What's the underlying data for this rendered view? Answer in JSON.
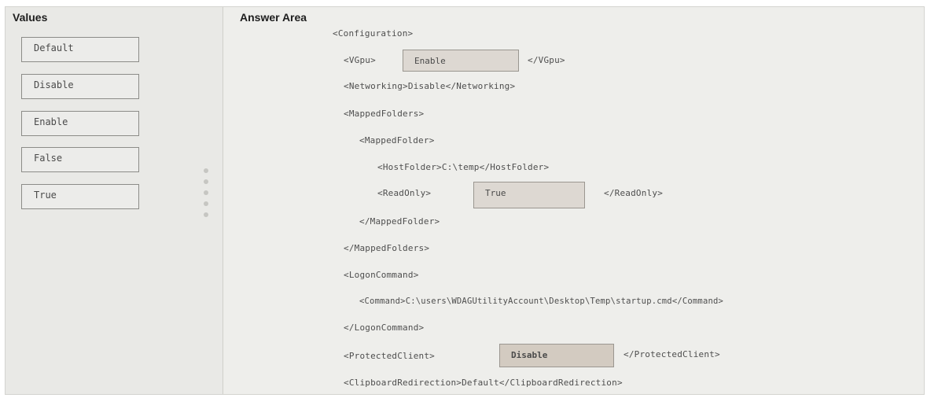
{
  "values_panel": {
    "title": "Values",
    "items": [
      "Default",
      "Disable",
      "Enable",
      "False",
      "True"
    ]
  },
  "answer_area": {
    "title": "Answer Area",
    "configuration_open": "<Configuration>",
    "vgpu_open": "<VGpu>",
    "vgpu_value": "Enable",
    "vgpu_close": "</VGpu>",
    "networking": "<Networking>Disable</Networking>",
    "mapped_folders_open": "<MappedFolders>",
    "mapped_folder_open": "<MappedFolder>",
    "host_folder": "<HostFolder>C:\\temp</HostFolder>",
    "read_only_open": "<ReadOnly>",
    "read_only_value": "True",
    "read_only_close": "</ReadOnly>",
    "mapped_folder_close": "</MappedFolder>",
    "mapped_folders_close": "</MappedFolders>",
    "logon_command_open": "<LogonCommand>",
    "command": "<Command>C:\\users\\WDAGUtilityAccount\\Desktop\\Temp\\startup.cmd</Command>",
    "logon_command_close": "</LogonCommand>",
    "protected_client_open": "<ProtectedClient>",
    "protected_client_value": "Disable",
    "protected_client_close": "</ProtectedClient>",
    "clipboard_redirection": "<ClipboardRedirection>Default</ClipboardRedirection>"
  }
}
